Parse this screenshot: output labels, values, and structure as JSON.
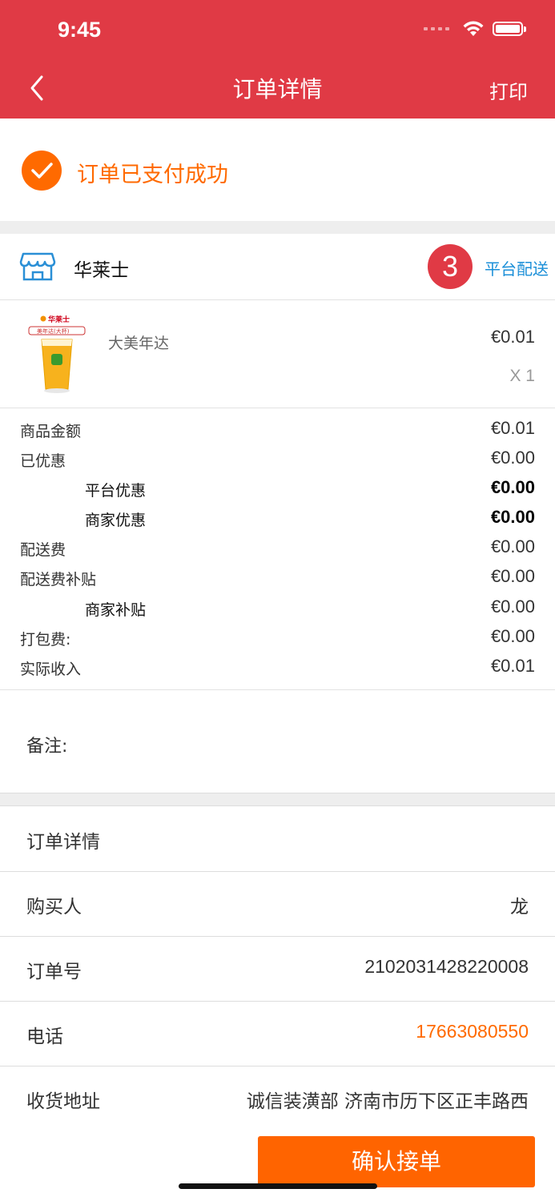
{
  "status_bar": {
    "time": "9:45"
  },
  "nav": {
    "title": "订单详情",
    "print": "打印"
  },
  "paid_status": "订单已支付成功",
  "store": {
    "name": "华莱士",
    "badge_count": "3",
    "delivery_type": "平台配送"
  },
  "product": {
    "name": "大美年达",
    "price": "€0.01",
    "qty": "X 1",
    "image_label": "华莱士 美年达(大杯)"
  },
  "amounts": [
    {
      "label": "商品金额",
      "value": "€0.01"
    },
    {
      "label": "已优惠",
      "value": "€0.00"
    },
    {
      "label": "平台优惠",
      "value": "€0.00"
    },
    {
      "label": "商家优惠",
      "value": "€0.00"
    },
    {
      "label": "配送费",
      "value": "€0.00"
    },
    {
      "label": "配送费补贴",
      "value": "€0.00"
    },
    {
      "label": "商家补贴",
      "value": "€0.00"
    },
    {
      "label": "打包费:",
      "value": "€0.00"
    },
    {
      "label": "实际收入",
      "value": "€0.01"
    }
  ],
  "remark_label": "备注:",
  "details": {
    "header": "订单详情",
    "buyer_label": "购买人",
    "buyer": "龙",
    "order_no_label": "订单号",
    "order_no": "2102031428220008",
    "phone_label": "电话",
    "phone": "17663080550",
    "address_label": "收货地址",
    "address": "诚信装潢部 济南市历下区正丰路西"
  },
  "confirm_button": "确认接单",
  "colors": {
    "header": "#e03a45",
    "accent": "#ff6a00",
    "link": "#1b8fd8"
  }
}
